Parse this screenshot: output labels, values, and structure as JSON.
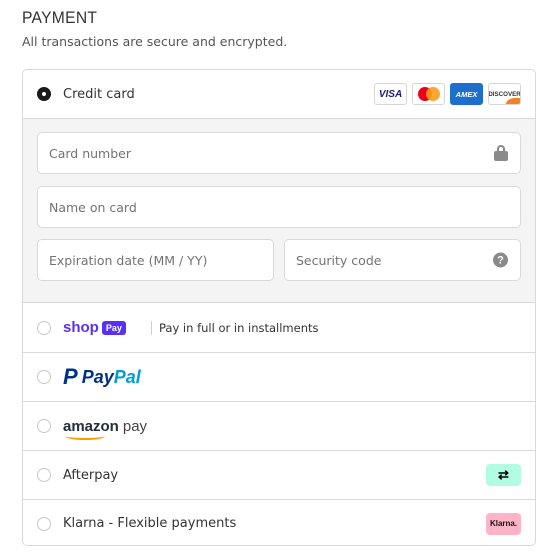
{
  "header": {
    "title": "PAYMENT",
    "subtitle": "All transactions are secure and encrypted."
  },
  "credit_card": {
    "label": "Credit card",
    "selected": true,
    "logos": [
      "VISA",
      "Mastercard",
      "AMEX",
      "DISCOVER"
    ],
    "fields": {
      "card_number": {
        "placeholder": "Card number",
        "icon": "lock-icon"
      },
      "name_on_card": {
        "placeholder": "Name on card"
      },
      "expiration": {
        "placeholder": "Expiration date (MM / YY)"
      },
      "security_code": {
        "placeholder": "Security code",
        "icon": "help-icon"
      }
    }
  },
  "shop_pay": {
    "logo_text": "shop",
    "logo_badge": "Pay",
    "description": "Pay in full or in installments"
  },
  "paypal": {
    "logo_mark": "P",
    "logo_text_1": "Pay",
    "logo_text_2": "Pal"
  },
  "amazon_pay": {
    "logo_text": "amazon",
    "logo_suffix": "pay"
  },
  "afterpay": {
    "label": "Afterpay",
    "badge": "⇄"
  },
  "klarna": {
    "label": "Klarna - Flexible payments",
    "badge": "Klarna."
  },
  "colors": {
    "shop_purple": "#5a31f4",
    "paypal_dark": "#003087",
    "paypal_light": "#009cde",
    "amazon_orange": "#ff9900",
    "afterpay_mint": "#b2fce4",
    "klarna_pink": "#ffb3c7",
    "amex_blue": "#1e6fcb"
  }
}
